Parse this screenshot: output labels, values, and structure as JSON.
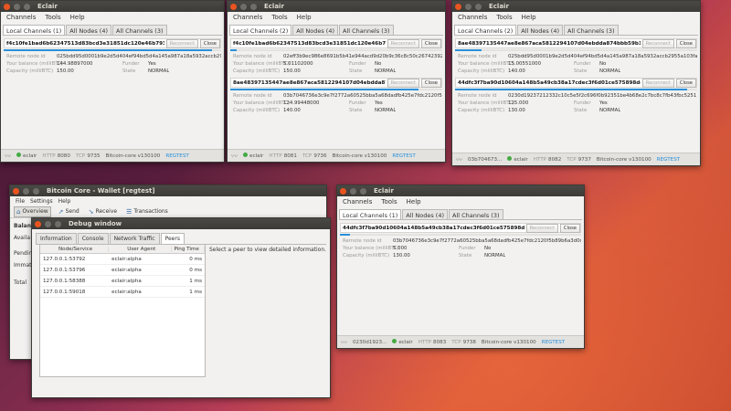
{
  "eclair_w1": {
    "title": "Eclair",
    "menu": [
      "Channels",
      "Tools",
      "Help"
    ],
    "tabs": [
      "Local Channels (1)",
      "All Nodes (4)",
      "All Channels (3)"
    ],
    "channel": {
      "id": "f4c10fe1bad6b62347513d83bcd3e31851dc120e46b7936fded8",
      "reconnect": "Reconnect",
      "close": "Close",
      "remote_node_id_label": "Remote node id",
      "remote_node_id": "025bdd95d0001b9e2d5d404ef94bd5d4a145a987a18a5932accb29",
      "balance_label": "Your balance (milliBTC)",
      "balance": "144.98897000",
      "funder_label": "Funder",
      "funder": "Yes",
      "capacity_label": "Capacity (milliBTC)",
      "capacity": "150.00",
      "state_label": "State",
      "state": "NORMAL"
    },
    "status": {
      "node": "eclair",
      "http_label": "HTTP",
      "http": "8080",
      "tcp_label": "TCP",
      "tcp": "9735",
      "core": "Bitcoin-core  v130100",
      "net": "REGTEST"
    }
  },
  "eclair_w2": {
    "title": "Eclair",
    "menu": [
      "Channels",
      "Tools",
      "Help"
    ],
    "tabs": [
      "Local Channels (2)",
      "All Nodes (4)",
      "All Channels (3)"
    ],
    "channels": [
      {
        "id": "f4c10fe1bad6b62347513d83bcd3e31851dc120e46b7936fded",
        "reconnect": "Reconnect",
        "close": "Close",
        "remote_node_id_label": "Remote node id",
        "remote_node_id": "02eff3b9ec986e8691b5b41e944acd9d20b9c36c8c50c267423924",
        "balance_label": "Your balance (milliBTC)",
        "balance": "5.01102000",
        "funder_label": "Funder",
        "funder": "No",
        "capacity_label": "Capacity (milliBTC)",
        "capacity": "150.00",
        "state_label": "State",
        "state": "NORMAL"
      },
      {
        "id": "8ae48397135447ae8e867aca5812294107d04ebdda874bbb59",
        "reconnect": "Reconnect",
        "close": "Close",
        "remote_node_id_label": "Remote node id",
        "remote_node_id": "03b7046736e3c9e7f2772a60525bba5a68dadfb425e7fdc2120f5b",
        "balance_label": "Your balance (milliBTC)",
        "balance": "124.99448000",
        "funder_label": "Funder",
        "funder": "Yes",
        "capacity_label": "Capacity (milliBTC)",
        "capacity": "140.00",
        "state_label": "State",
        "state": "NORMAL"
      }
    ],
    "status": {
      "node": "eclair",
      "http_label": "HTTP",
      "http": "8081",
      "tcp_label": "TCP",
      "tcp": "9736",
      "core": "Bitcoin-core  v130100",
      "net": "REGTEST"
    }
  },
  "eclair_w3": {
    "title": "Eclair",
    "menu": [
      "Channels",
      "Tools",
      "Help"
    ],
    "tabs": [
      "Local Channels (2)",
      "All Nodes (4)",
      "All Channels (3)"
    ],
    "channels": [
      {
        "id": "8ae48397135447ae8e867aca5812294107d04ebdda874bbb59b14fe3fd31",
        "reconnect": "Reconnect",
        "close": "Close",
        "remote_node_id_label": "Remote node id",
        "remote_node_id": "025bdd95d0001b9e2d5d404ef94bd5d4a145a987a18a5932accb2955a103fa11",
        "balance_label": "Your balance (milliBTC)",
        "balance": "15.00551000",
        "funder_label": "Funder",
        "funder": "No",
        "capacity_label": "Capacity (milliBTC)",
        "capacity": "140.00",
        "state_label": "State",
        "state": "NORMAL"
      },
      {
        "id": "44dfc3f7ba90d10604a148b5a49cb38a17cdec3f6d01ce575898dcb8fa684",
        "reconnect": "Reconnect",
        "close": "Close",
        "remote_node_id_label": "Remote node id",
        "remote_node_id": "0230d19237212332c10c5e5f2c696f0b92351be4b68e2c7bc8c7fb43fbc5251",
        "balance_label": "Your balance (milliBTC)",
        "balance": "125.000",
        "funder_label": "Funder",
        "funder": "Yes",
        "capacity_label": "Capacity (milliBTC)",
        "capacity": "130.00",
        "state_label": "State",
        "state": "NORMAL"
      }
    ],
    "status": {
      "node_id": "03b704673...",
      "node": "eclair",
      "http_label": "HTTP",
      "http": "8082",
      "tcp_label": "TCP",
      "tcp": "9737",
      "core": "Bitcoin-core  v130100",
      "net": "REGTEST"
    }
  },
  "eclair_w4": {
    "title": "Eclair",
    "menu": [
      "Channels",
      "Tools",
      "Help"
    ],
    "tabs": [
      "Local Channels (1)",
      "All Nodes (4)",
      "All Channels (3)"
    ],
    "channel": {
      "id": "44dfc3f7ba90d10604a148b5a49cb38a17cdec3f6d01ce575898dcb8fa684",
      "reconnect": "Reconnect",
      "close": "Close",
      "remote_node_id_label": "Remote node id",
      "remote_node_id": "03b7046736e3c9e7f2772a60525bba5a68dadfb425e7fdc2120f5b89b6a3d0d0c",
      "balance_label": "Your balance (milliBTC)",
      "balance": "5.000",
      "funder_label": "Funder",
      "funder": "No",
      "capacity_label": "Capacity (milliBTC)",
      "capacity": "130.00",
      "state_label": "State",
      "state": "NORMAL"
    },
    "status": {
      "node_id": "0230d1923...",
      "node": "eclair",
      "http_label": "HTTP",
      "http": "8083",
      "tcp_label": "TCP",
      "tcp": "9738",
      "core": "Bitcoin-core  v130100",
      "net": "REGTEST"
    }
  },
  "bitcoin_core": {
    "title": "Bitcoin Core - Wallet [regtest]",
    "menu": [
      "File",
      "Settings",
      "Help"
    ],
    "toolbar": [
      "Overview",
      "Send",
      "Receive",
      "Transactions"
    ],
    "side_labels": [
      "Balan",
      "Availa",
      "Pendin",
      "Immat",
      "Total"
    ]
  },
  "debug_window": {
    "title": "Debug window",
    "tabs": [
      "Information",
      "Console",
      "Network Traffic",
      "Peers"
    ],
    "columns": [
      "Node/Service",
      "User Agent",
      "Ping Time"
    ],
    "peers": [
      {
        "node": "127.0.0.1:53792",
        "agent": "eclair:alpha",
        "ping": "0 ms"
      },
      {
        "node": "127.0.0.1:53796",
        "agent": "eclair:alpha",
        "ping": "0 ms"
      },
      {
        "node": "127.0.0.1:58388",
        "agent": "eclair:alpha",
        "ping": "1 ms"
      },
      {
        "node": "127.0.0.1:59018",
        "agent": "eclair:alpha",
        "ping": "1 ms"
      }
    ],
    "info": "Select a peer to view detailed information."
  },
  "colors": {
    "accent": "#2a90d9",
    "titlebar": "#3c3b37",
    "close": "#e95420",
    "status_ok": "#44aa44"
  }
}
